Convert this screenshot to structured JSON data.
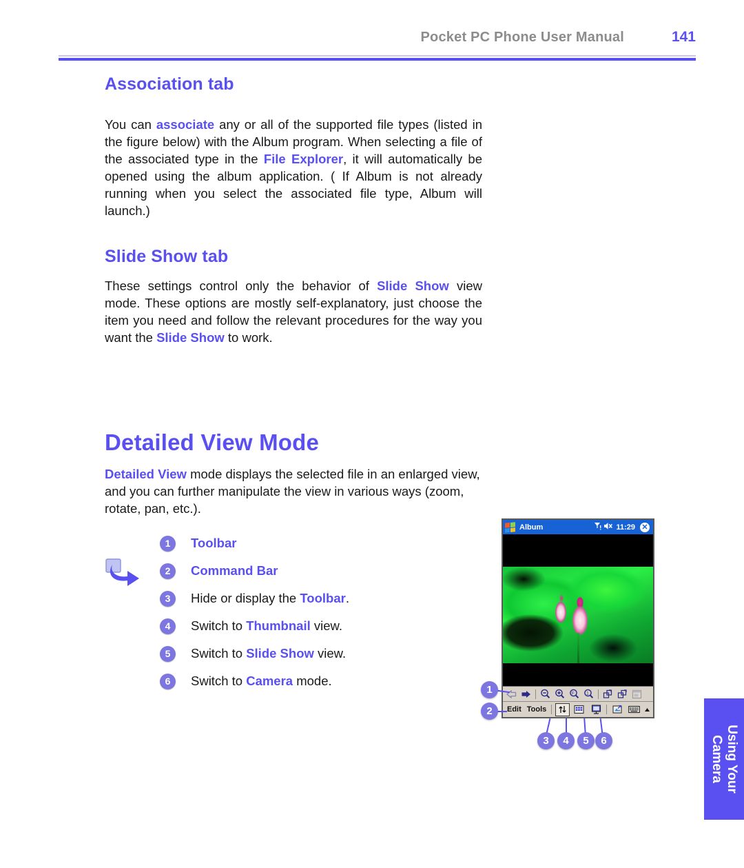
{
  "header": {
    "title": "Pocket PC Phone User Manual",
    "page_number": "141"
  },
  "sections": {
    "association": {
      "heading": "Association tab",
      "paragraph": {
        "part1": "You can ",
        "hl1": "associate",
        "part2": " any or all of the supported file types (listed in the figure below) with the Album program. When selecting a file of the associated type in the ",
        "hl2": "File Explorer",
        "part3": ", it will automatically be opened using the album application. ( If Album is not already running when you select the associated file type, Album will launch.)"
      }
    },
    "slideshow": {
      "heading": "Slide Show tab",
      "paragraph": {
        "part1": "These settings control only the behavior of ",
        "hl1": "Slide Show",
        "part2": " view mode. These options are mostly self-explanatory, just choose the item you need and follow the relevant procedures for the way you want the ",
        "hl2": "Slide Show",
        "part3": " to work."
      }
    },
    "detailed_view": {
      "heading": "Detailed View Mode",
      "paragraph": {
        "hl1": "Detailed View",
        "part1": " mode displays the selected file in an enlarged view, and you can further manipulate the view in various ways (zoom, rotate, pan, etc.)."
      }
    }
  },
  "legend": [
    {
      "num": "1",
      "text": "Toolbar",
      "style": "strong"
    },
    {
      "num": "2",
      "text": "Command Bar",
      "style": "strong"
    },
    {
      "num": "3",
      "pre": "Hide or display the ",
      "hl": "Toolbar",
      "post": ".",
      "style": "mixed"
    },
    {
      "num": "4",
      "pre": "Switch to ",
      "hl": "Thumbnail",
      "post": " view.",
      "style": "mixed"
    },
    {
      "num": "5",
      "pre": "Switch to ",
      "hl": "Slide Show",
      "post": " view.",
      "style": "mixed"
    },
    {
      "num": "6",
      "pre": "Switch to ",
      "hl": "Camera",
      "post": " mode.",
      "style": "mixed"
    }
  ],
  "note_icon": "note-arrow-icon",
  "device": {
    "titlebar": {
      "app_name": "Album",
      "signal_icon": "signal-strength-icon",
      "volume_icon": "volume-muted-icon",
      "time": "11:29",
      "close_label": "✕"
    },
    "photo_alt": "lotus-flower-photo",
    "toolbar_buttons": [
      {
        "name": "previous-image-button",
        "glyph": "⇦",
        "state": "disabled"
      },
      {
        "name": "next-image-button",
        "glyph": "⇨",
        "state": "enabled"
      },
      {
        "name": "zoom-out-button",
        "glyph": "🔍",
        "state": "enabled"
      },
      {
        "name": "zoom-in-button",
        "glyph": "🔍",
        "state": "enabled"
      },
      {
        "name": "fit-to-screen-button",
        "glyph": "🔍",
        "state": "enabled"
      },
      {
        "name": "actual-size-button",
        "glyph": "🔍",
        "state": "enabled"
      },
      {
        "name": "rotate-left-button",
        "glyph": "⟲",
        "state": "enabled"
      },
      {
        "name": "rotate-right-button",
        "glyph": "⟳",
        "state": "enabled"
      },
      {
        "name": "full-screen-button",
        "glyph": "▣",
        "state": "enabled"
      }
    ],
    "command_bar": {
      "menu_edit": "Edit",
      "menu_tools": "Tools",
      "toggle_toolbar_button": "toggle-toolbar-button",
      "thumbnail_view_button": "thumbnail-view-button",
      "slide_show_button": "slide-show-button",
      "camera_mode_button": "camera-mode-button",
      "keyboard_button": "soft-keyboard-button",
      "input_chevron": "input-panel-chevron"
    },
    "callouts": [
      "1",
      "2",
      "3",
      "4",
      "5",
      "6"
    ]
  },
  "side_tab": {
    "line1": "Using Your",
    "line2": "Camera",
    "color": "#5a4ff0"
  },
  "colors": {
    "accent": "#5a50f0",
    "badge": "#7d76e0",
    "header_gray": "#8c8c8c",
    "titlebar_blue": "#1763d6"
  }
}
